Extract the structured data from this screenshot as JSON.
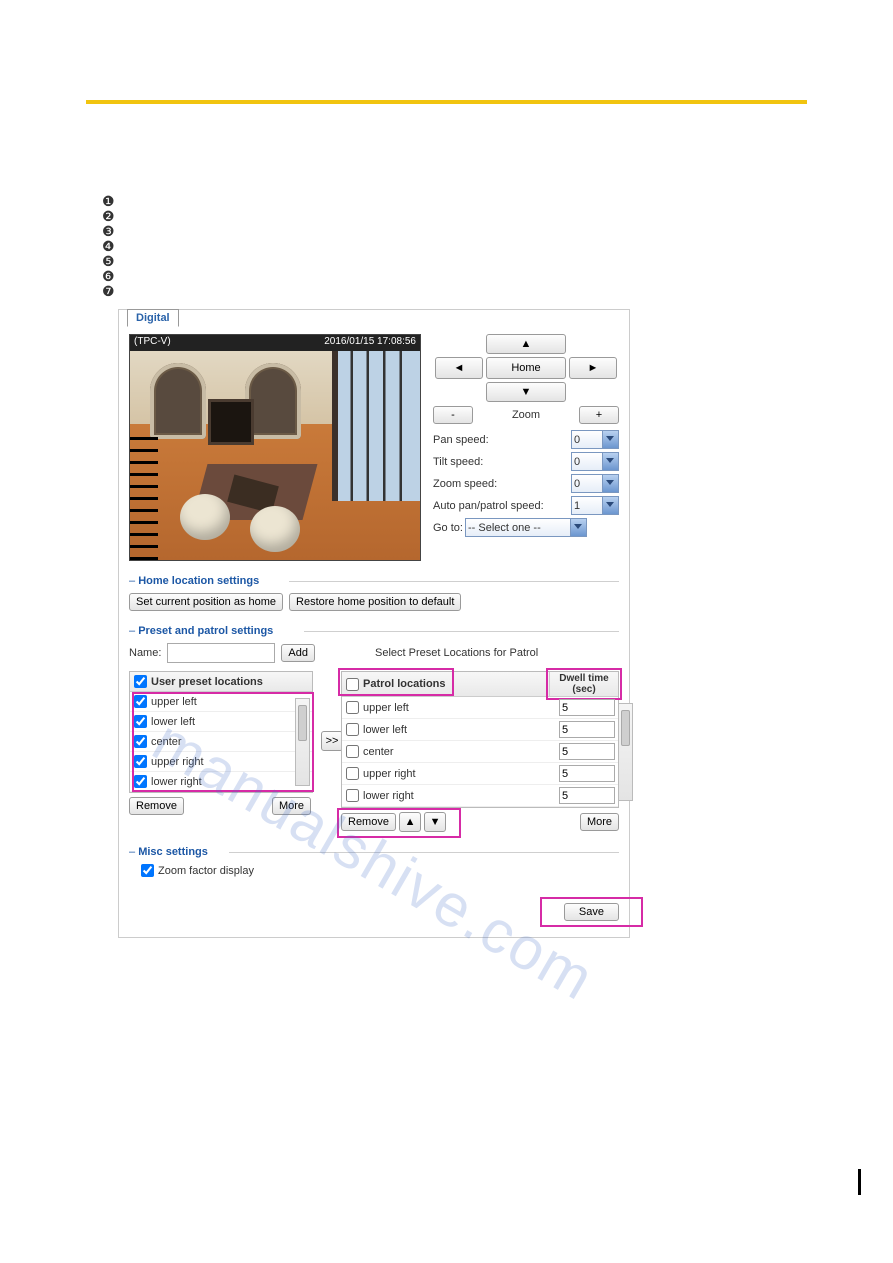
{
  "tab": "Digital",
  "preview": {
    "device": "(TPC-V)",
    "timestamp": "2016/01/15  17:08:56"
  },
  "dpad": {
    "up": "▲",
    "down": "▼",
    "left": "◄",
    "right": "►",
    "home": "Home"
  },
  "zoom": {
    "minus": "-",
    "label": "Zoom",
    "plus": "+"
  },
  "speeds": {
    "pan": {
      "label": "Pan speed:",
      "value": "0"
    },
    "tilt": {
      "label": "Tilt speed:",
      "value": "0"
    },
    "zoom": {
      "label": "Zoom speed:",
      "value": "0"
    },
    "auto": {
      "label": "Auto pan/patrol speed:",
      "value": "1"
    },
    "goto": {
      "label": "Go to:",
      "value": "-- Select one --"
    }
  },
  "home_section": {
    "title": "Home location settings",
    "set_btn": "Set current position as home",
    "restore_btn": "Restore home position to default"
  },
  "preset_section": {
    "title": "Preset and patrol settings",
    "name_label": "Name:",
    "add_btn": "Add",
    "select_label": "Select Preset Locations for Patrol"
  },
  "user_list": {
    "header": "User preset locations",
    "items": [
      {
        "label": "upper left",
        "checked": true
      },
      {
        "label": "lower left",
        "checked": true
      },
      {
        "label": "center",
        "checked": true
      },
      {
        "label": "upper right",
        "checked": true
      },
      {
        "label": "lower right",
        "checked": true
      }
    ],
    "remove_btn": "Remove",
    "more_btn": "More"
  },
  "patrol_list": {
    "header": "Patrol locations",
    "dwell_header": "Dwell time (sec)",
    "items": [
      {
        "label": "upper left",
        "dwell": "5"
      },
      {
        "label": "lower left",
        "dwell": "5"
      },
      {
        "label": "center",
        "dwell": "5"
      },
      {
        "label": "upper right",
        "dwell": "5"
      },
      {
        "label": "lower right",
        "dwell": "5"
      }
    ],
    "remove_btn": "Remove",
    "up_btn": "▲",
    "down_btn": "▼",
    "more_btn": "More"
  },
  "misc_section": {
    "title": "Misc settings",
    "zoom_factor_label": "Zoom factor display"
  },
  "save_btn": "Save",
  "bullets": [
    "❶",
    "❷",
    "❸",
    "❹",
    "❺",
    "❻",
    "❼"
  ],
  "transfer_btn": ">>"
}
